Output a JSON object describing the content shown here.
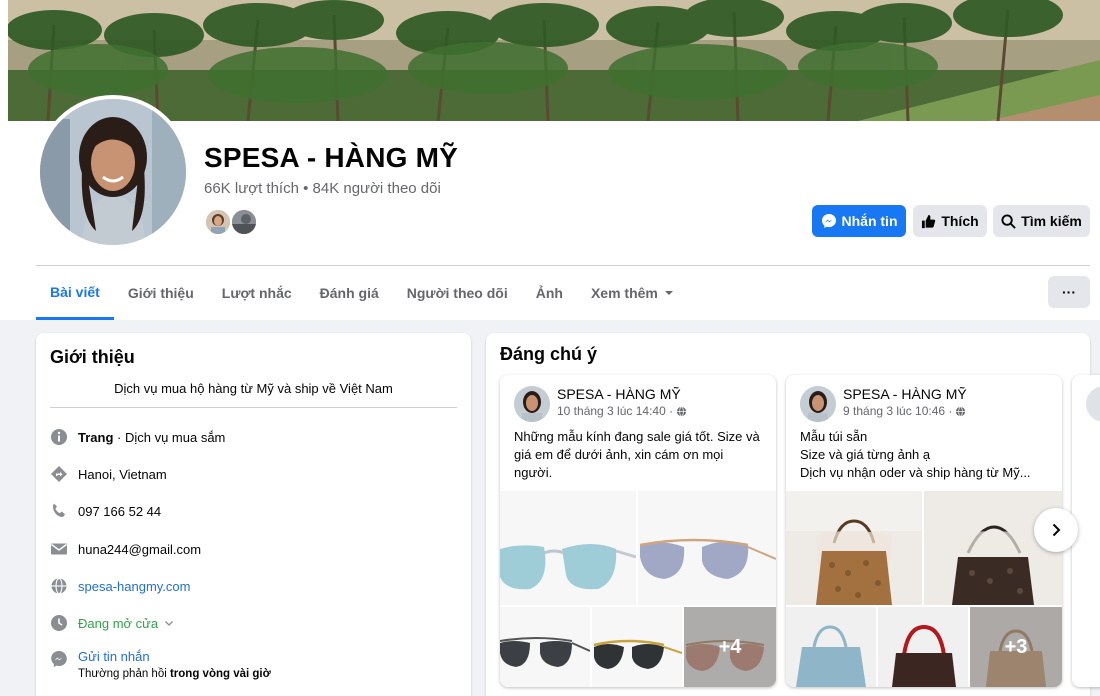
{
  "page": {
    "name": "SPESA - HÀNG MỸ",
    "stats": "66K lượt thích • 84K người theo dõi"
  },
  "actions": {
    "message": "Nhắn tin",
    "like": "Thích",
    "search": "Tìm kiếm",
    "more": "···"
  },
  "tabs": [
    {
      "label": "Bài viết"
    },
    {
      "label": "Giới thiệu"
    },
    {
      "label": "Lượt nhắc"
    },
    {
      "label": "Đánh giá"
    },
    {
      "label": "Người theo dõi"
    },
    {
      "label": "Ảnh"
    },
    {
      "label": "Xem thêm"
    }
  ],
  "intro": {
    "title": "Giới thiệu",
    "description": "Dịch vụ mua hộ hàng từ Mỹ và ship về Việt Nam",
    "category_label": "Trang",
    "category_value": " · Dịch vụ mua sắm",
    "location": "Hanoi, Vietnam",
    "phone": "097 166 52 44",
    "email": "huna244@gmail.com",
    "website": "spesa-hangmy.com",
    "hours": "Đang mở cửa",
    "message_link": "Gửi tin nhắn",
    "response_prefix": "Thường phản hồi ",
    "response_time": "trong vòng vài giờ"
  },
  "featured": {
    "title": "Đáng chú ý",
    "posts": [
      {
        "author": "SPESA - HÀNG MỸ",
        "time": "10 tháng 3 lúc 14:40 ·",
        "text": "Những mẫu kính đang sale giá tốt. Size và giá em để dưới ảnh, xin cám ơn mọi người.",
        "more_count": "+4"
      },
      {
        "author": "SPESA - HÀNG MỸ",
        "time": "9 tháng 3 lúc 10:46 ·",
        "text_lines": [
          "Mẫu túi sẵn",
          "Size và giá từng ảnh ạ",
          "Dịch vụ nhận oder và ship hàng từ Mỹ..."
        ],
        "more_count": "+3"
      }
    ]
  },
  "colors": {
    "accent": "#1877f2",
    "open_status": "#31a24c",
    "link": "#216fdb"
  }
}
